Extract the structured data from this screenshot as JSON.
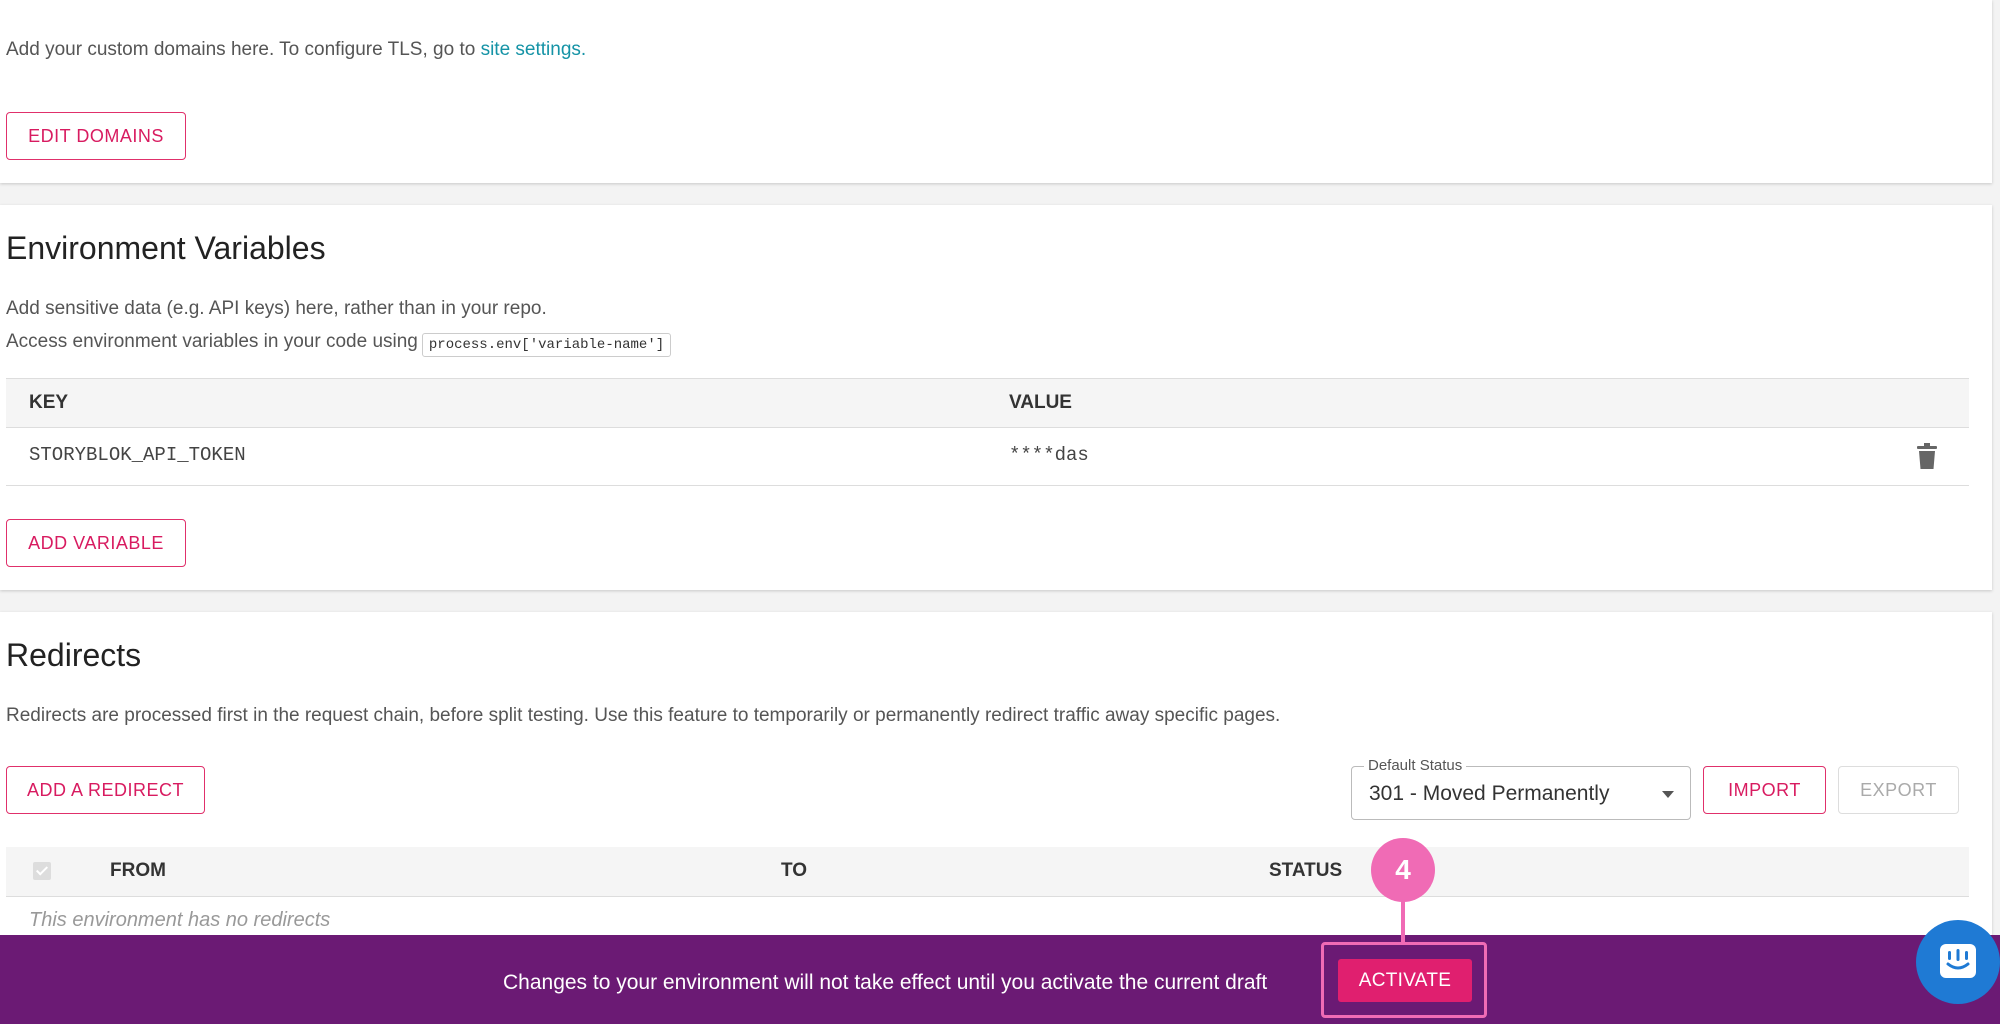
{
  "domains": {
    "description_prefix": "Add your custom domains here. To configure TLS, go to ",
    "site_settings_link": "site settings.",
    "edit_button": "EDIT DOMAINS"
  },
  "env": {
    "title": "Environment Variables",
    "desc_line1": "Add sensitive data (e.g. API keys) here, rather than in your repo.",
    "desc_line2": "Access environment variables in your code using",
    "code_sample": "process.env['variable-name']",
    "columns": {
      "key": "KEY",
      "value": "VALUE"
    },
    "rows": [
      {
        "key": "STORYBLOK_API_TOKEN",
        "value": "****das"
      }
    ],
    "add_button": "ADD VARIABLE"
  },
  "redirects": {
    "title": "Redirects",
    "description": "Redirects are processed first in the request chain, before split testing. Use this feature to temporarily or permanently redirect traffic away specific pages.",
    "add_button": "ADD A REDIRECT",
    "default_status_label": "Default Status",
    "default_status_value": "301 - Moved Permanently",
    "import_button": "IMPORT",
    "export_button": "EXPORT",
    "columns": {
      "from": "FROM",
      "to": "TO",
      "status": "STATUS"
    },
    "empty_message": "This environment has no redirects"
  },
  "banner": {
    "message": "Changes to your environment will not take effect until you activate the current draft",
    "activate_button": "ACTIVATE"
  },
  "callout": {
    "number": "4"
  },
  "colors": {
    "accent": "#e01f6f",
    "banner_bg": "#6b1a74",
    "link": "#1593a6",
    "callout": "#f06bb5",
    "chat": "#1f7ad4"
  },
  "icons": {
    "trash": "trash-icon",
    "chat": "chat-icon",
    "caret": "caret-down-icon"
  }
}
